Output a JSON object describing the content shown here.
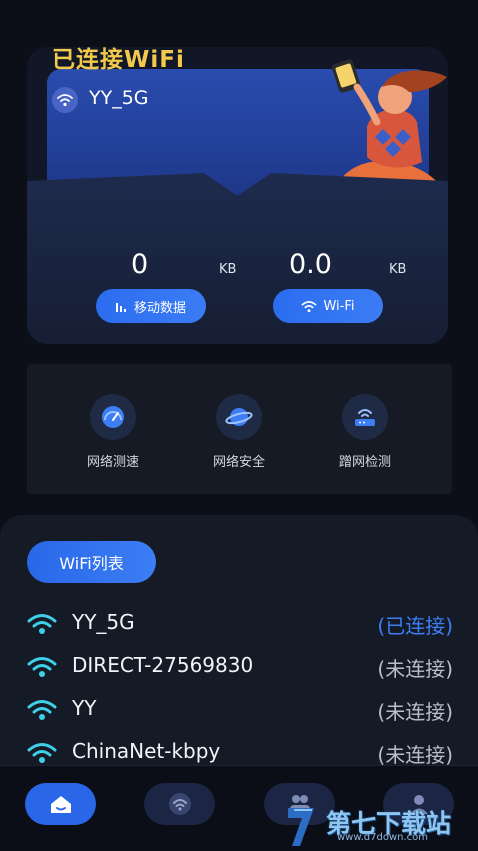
{
  "header": {
    "title": "已连接WiFi",
    "ssid": "YY_5G"
  },
  "stats": {
    "mobile": {
      "value": "0",
      "unit": "KB",
      "label": "移动数据"
    },
    "wifi": {
      "value": "0.0",
      "unit": "KB",
      "label": "Wi-Fi"
    }
  },
  "tools": [
    {
      "label": "网络测速",
      "icon": "speedometer-icon"
    },
    {
      "label": "网络安全",
      "icon": "planet-icon"
    },
    {
      "label": "蹭网检测",
      "icon": "router-icon"
    }
  ],
  "wifi_list": {
    "title": "WiFi列表",
    "items": [
      {
        "name": "YY_5G",
        "status": "(已连接)",
        "connected": true
      },
      {
        "name": "DIRECT-27569830",
        "status": "(未连接)",
        "connected": false
      },
      {
        "name": "YY",
        "status": "(未连接)",
        "connected": false
      },
      {
        "name": "ChinaNet-kbpy",
        "status": "(未连接)",
        "connected": false
      }
    ]
  },
  "nav": [
    {
      "icon": "home-icon",
      "active": true
    },
    {
      "icon": "wifi-icon",
      "active": false
    },
    {
      "icon": "people-icon",
      "active": false
    },
    {
      "icon": "user-icon",
      "active": false
    }
  ],
  "watermark": {
    "text": "第七下载站",
    "url": "www.d7down.com"
  },
  "colors": {
    "accent": "#2c6df0",
    "title_gold": "#f2c94c",
    "connected": "#3d7ef5",
    "wifi_icon": "#3fd0e8"
  }
}
